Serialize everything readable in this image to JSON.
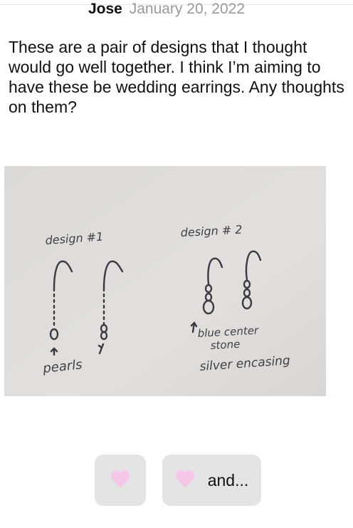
{
  "post": {
    "author": "Jose",
    "date": "January 20, 2022",
    "text": "These are a pair of designs that I thought would go well together. I think I’m aiming to have these be wedding earrings. Any thoughts on them?"
  },
  "photo": {
    "labels": {
      "design1": "design #1",
      "design2": "design # 2",
      "pearls": "pearls",
      "blue_center": "blue center",
      "stone": "stone",
      "silver_encasing": "silver encasing"
    }
  },
  "buttons": {
    "and_label": "and..."
  },
  "colors": {
    "heart": "#f6c6e9",
    "button_bg": "#e4e4e4",
    "date": "#9a9a9a",
    "paper": "#dedbd8"
  },
  "icons": {
    "like_button": "heart-icon",
    "and_button": "heart-icon"
  }
}
